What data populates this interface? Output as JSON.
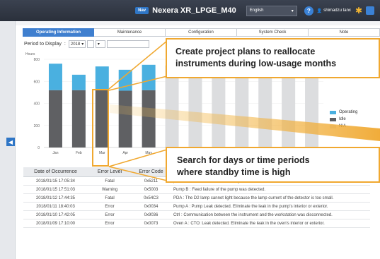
{
  "topbar": {
    "badge": "Nav",
    "instrument_title": "Nexera XR_LPGE_M40",
    "language": "English",
    "help": "?",
    "user": "shimadzu tanx"
  },
  "tabs": [
    {
      "label": "Operating Information",
      "active": true
    },
    {
      "label": "Maintenance",
      "active": false
    },
    {
      "label": "Configuration",
      "active": false
    },
    {
      "label": "System Check",
      "active": false
    },
    {
      "label": "Note",
      "active": false
    }
  ],
  "period": {
    "label": "Period to Display",
    "year": "2018",
    "month": "",
    "extra": ""
  },
  "chart_data": {
    "type": "bar",
    "stacked": true,
    "ylabel": "Hours",
    "ylim": [
      0,
      800
    ],
    "yticks": [
      0,
      200,
      400,
      600,
      800
    ],
    "categories": [
      "Jan",
      "Feb",
      "Mar",
      "Apr",
      "May",
      "",
      "",
      "",
      "",
      "",
      "",
      ""
    ],
    "series": [
      {
        "name": "Idle",
        "color": "#5f6063",
        "values": [
          520,
          520,
          525,
          515,
          520,
          0,
          0,
          0,
          0,
          0,
          0,
          0
        ]
      },
      {
        "name": "Operating",
        "color": "#4ab0e0",
        "values": [
          240,
          140,
          210,
          190,
          230,
          0,
          0,
          0,
          0,
          0,
          0,
          0
        ]
      },
      {
        "name": "N/A",
        "color": "#dcdddf",
        "values": [
          0,
          0,
          0,
          0,
          0,
          744,
          744,
          744,
          744,
          744,
          744,
          744
        ]
      }
    ]
  },
  "legend": [
    {
      "label": "Operating",
      "color": "#4ab0e0"
    },
    {
      "label": "Idle",
      "color": "#5f6063"
    },
    {
      "label": "N/A",
      "color": "#dcdddf"
    }
  ],
  "table": {
    "headers": [
      "Date of Occurrence",
      "Error Level",
      "Error Code",
      ""
    ],
    "rows": [
      [
        "2018/01/15 17:05:34",
        "Fatal",
        "0x5211",
        "pressure control for the abnormality was detected."
      ],
      [
        "2018/01/15 17:51:03",
        "Warning",
        "0x5003",
        "Pump B : Feed failure of the pump was detected."
      ],
      [
        "2018/01/12 17:44:35",
        "Fatal",
        "0x54C3",
        "PDA : The D2 lamp cannot light because the lamp current of the detector is too small."
      ],
      [
        "2018/01/11 18:40:03",
        "Error",
        "0x0034",
        "Pump A : Pump Leak detected. Eliminate the leak in the pump's interior or exterior."
      ],
      [
        "2018/01/10 17:42:05",
        "Error",
        "0x9036",
        "Ctrl : Communication between the instrument and the workstation was disconnected."
      ],
      [
        "2018/01/09 17:10:00",
        "Error",
        "0x0073",
        "Oven A : CTO: Leak detected. Eliminate the leak in the oven's interior or exterior."
      ]
    ]
  },
  "callouts": {
    "top_line1": "Create project plans to reallocate",
    "top_line2": "instruments during low-usage months",
    "bottom_line1": "Search for days or time periods",
    "bottom_line2": "where standby time is high"
  },
  "icons": [
    "dropdown-arrow-icon",
    "help-icon",
    "user-icon",
    "gear-icon",
    "window-icon",
    "left-arrow-icon"
  ]
}
